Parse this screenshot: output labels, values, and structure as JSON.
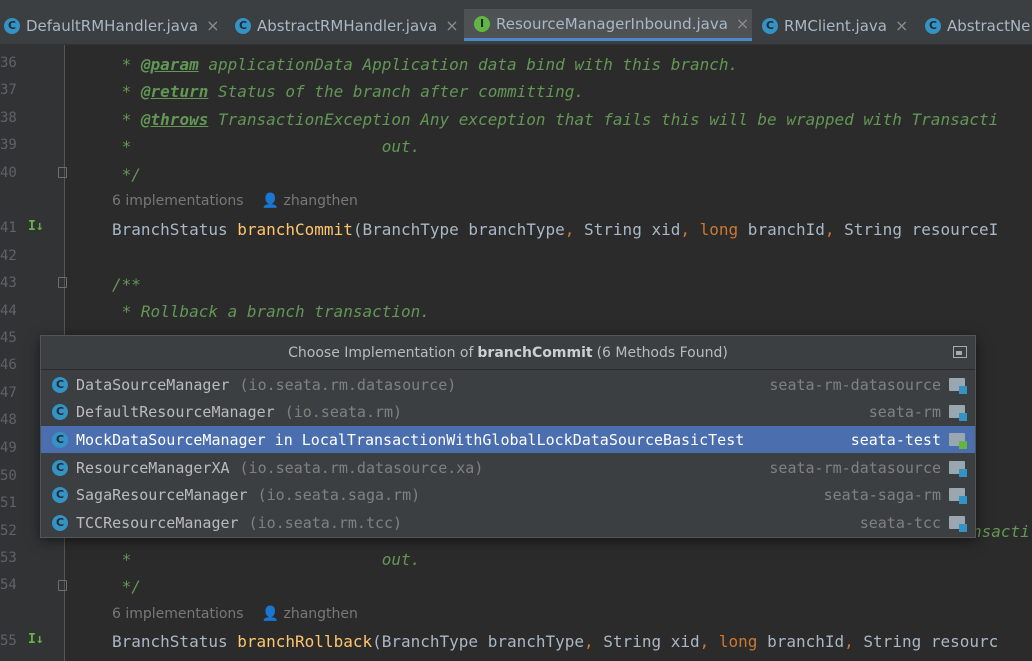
{
  "tabs": [
    {
      "label": "DefaultRMHandler.java",
      "icon": "class-icon",
      "active": false
    },
    {
      "label": "AbstractRMHandler.java",
      "icon": "abstract-class-icon",
      "active": false
    },
    {
      "label": "ResourceManagerInbound.java",
      "icon": "interface-icon",
      "active": true
    },
    {
      "label": "RMClient.java",
      "icon": "class-icon",
      "active": false
    },
    {
      "label": "AbstractNe",
      "icon": "abstract-class-icon",
      "active": false
    }
  ],
  "gutter": {
    "lines": [
      "36",
      "37",
      "38",
      "39",
      "40",
      "41",
      "42",
      "43",
      "44",
      "45",
      "46",
      "47",
      "48",
      "49",
      "50",
      "51",
      "52",
      "53",
      "54",
      "55"
    ]
  },
  "code": {
    "l36": {
      "tag": "@param",
      "text": " applicationData Application data bind with this branch."
    },
    "l37": {
      "tag": "@return",
      "text": " Status of the branch after committing."
    },
    "l38": {
      "tag": "@throws",
      "text": " TransactionException Any exception that fails this will be wrapped with Transacti"
    },
    "l39": " *                          out.",
    "l40": " */",
    "hint1": {
      "implementations": "6 implementations",
      "user": "zhangthen"
    },
    "l41": {
      "type": "BranchStatus ",
      "method": "branchCommit",
      "p1": "(BranchType branchType",
      "c1": ",",
      "p2": " String xid",
      "c2": ",",
      "kw": " long",
      "p3": " branchId",
      "c3": ",",
      "p4": " String resourceI"
    },
    "l43": "/**",
    "l44": " * Rollback a branch transaction.",
    "l52": "nsacti",
    "l53": " *                          out.",
    "l54": " */",
    "hint2": {
      "implementations": "6 implementations",
      "user": "zhangthen"
    },
    "l55": {
      "type": "BranchStatus ",
      "method": "branchRollback",
      "p1": "(BranchType branchType",
      "c1": ",",
      "p2": " String xid",
      "c2": ",",
      "kw": " long",
      "p3": " branchId",
      "c3": ",",
      "p4": " String resourc"
    }
  },
  "popup": {
    "title_prefix": "Choose Implementation of",
    "title_method": "branchCommit",
    "title_suffix": "(6 Methods Found)",
    "items": [
      {
        "name": "DataSourceManager",
        "pkg": "(io.seata.rm.datasource)",
        "module": "seata-rm-datasource",
        "selected": false
      },
      {
        "name": "DefaultResourceManager",
        "pkg": "(io.seata.rm)",
        "module": "seata-rm",
        "selected": false
      },
      {
        "name": "MockDataSourceManager in LocalTransactionWithGlobalLockDataSourceBasicTest",
        "pkg": "",
        "module": "seata-test",
        "selected": true
      },
      {
        "name": "ResourceManagerXA",
        "pkg": "(io.seata.rm.datasource.xa)",
        "module": "seata-rm-datasource",
        "selected": false
      },
      {
        "name": "SagaResourceManager",
        "pkg": "(io.seata.saga.rm)",
        "module": "seata-saga-rm",
        "selected": false
      },
      {
        "name": "TCCResourceManager",
        "pkg": "(io.seata.rm.tcc)",
        "module": "seata-tcc",
        "selected": false
      }
    ]
  },
  "colors": {
    "accent": "#4b6eaf",
    "comment": "#629755",
    "keyword": "#cc7832",
    "method": "#ffc66d"
  }
}
